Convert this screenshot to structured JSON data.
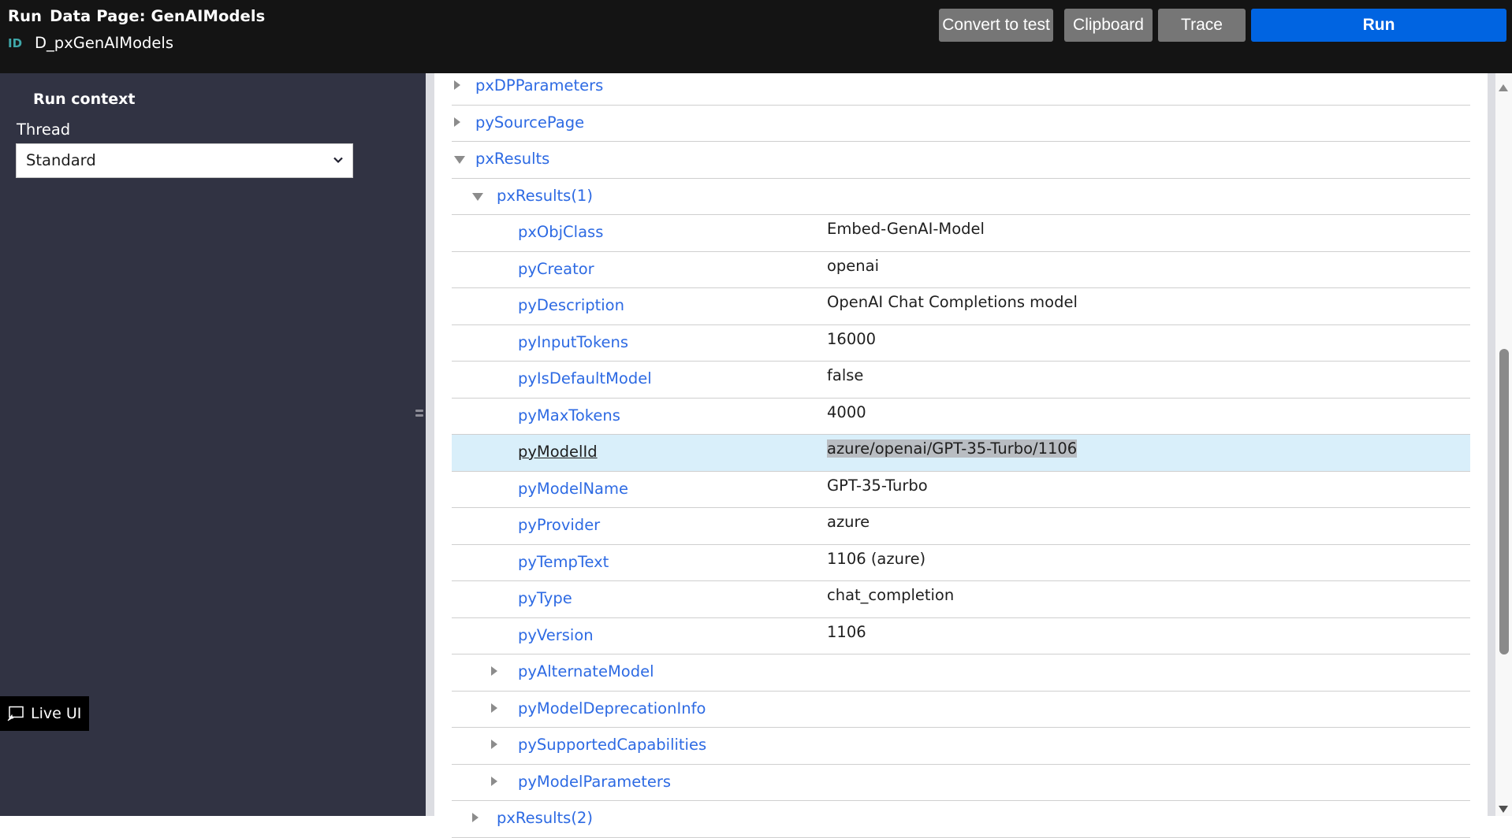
{
  "header": {
    "run_label": "Run",
    "title": "Data Page:  GenAIModels",
    "id_tag": "ID",
    "id_value": "D_pxGenAIModels",
    "buttons": {
      "convert_to_test": "Convert to test",
      "clipboard": "Clipboard",
      "trace": "Trace",
      "run": "Run"
    },
    "colors": {
      "background": "#141414",
      "secondary_button": "#767676",
      "primary_button": "#0064e1",
      "id_tag": "#3fa7a9"
    }
  },
  "sidebar": {
    "section_title": "Run context",
    "thread_label": "Thread",
    "thread_selected": "Standard",
    "live_ui_label": "Live UI",
    "colors": {
      "background": "#313343"
    }
  },
  "tree": {
    "rows": [
      {
        "label": "pxDPParameters",
        "level": 0,
        "toggle": "collapsed",
        "value": ""
      },
      {
        "label": "pySourcePage",
        "level": 0,
        "toggle": "collapsed",
        "value": ""
      },
      {
        "label": "pxResults",
        "level": 0,
        "toggle": "expanded",
        "value": ""
      },
      {
        "label": "pxResults(1)",
        "level": 1,
        "toggle": "expanded",
        "value": ""
      },
      {
        "label": "pxObjClass",
        "level": 2,
        "toggle": "none",
        "value": "Embed-GenAI-Model"
      },
      {
        "label": "pyCreator",
        "level": 2,
        "toggle": "none",
        "value": "openai"
      },
      {
        "label": "pyDescription",
        "level": 2,
        "toggle": "none",
        "value": "OpenAI Chat Completions model"
      },
      {
        "label": "pyInputTokens",
        "level": 2,
        "toggle": "none",
        "value": "16000"
      },
      {
        "label": "pyIsDefaultModel",
        "level": 2,
        "toggle": "none",
        "value": "false"
      },
      {
        "label": "pyMaxTokens",
        "level": 2,
        "toggle": "none",
        "value": "4000"
      },
      {
        "label": "pyModelId",
        "level": 2,
        "toggle": "none",
        "value": "azure/openai/GPT-35-Turbo/1106",
        "selected": true
      },
      {
        "label": "pyModelName",
        "level": 2,
        "toggle": "none",
        "value": "GPT-35-Turbo"
      },
      {
        "label": "pyProvider",
        "level": 2,
        "toggle": "none",
        "value": "azure"
      },
      {
        "label": "pyTempText",
        "level": 2,
        "toggle": "none",
        "value": "1106 (azure)"
      },
      {
        "label": "pyType",
        "level": 2,
        "toggle": "none",
        "value": "chat_completion"
      },
      {
        "label": "pyVersion",
        "level": 2,
        "toggle": "none",
        "value": "1106"
      },
      {
        "label": "pyAlternateModel",
        "level": 2,
        "toggle": "collapsed",
        "value": ""
      },
      {
        "label": "pyModelDeprecationInfo",
        "level": 2,
        "toggle": "collapsed",
        "value": ""
      },
      {
        "label": "pySupportedCapabilities",
        "level": 2,
        "toggle": "collapsed",
        "value": ""
      },
      {
        "label": "pyModelParameters",
        "level": 2,
        "toggle": "collapsed",
        "value": ""
      },
      {
        "label": "pxResults(2)",
        "level": 1,
        "toggle": "collapsed",
        "value": ""
      }
    ],
    "colors": {
      "link": "#2d6ae3",
      "selected_row": "#d9effa",
      "text_selection": "#b9bdc2"
    }
  }
}
